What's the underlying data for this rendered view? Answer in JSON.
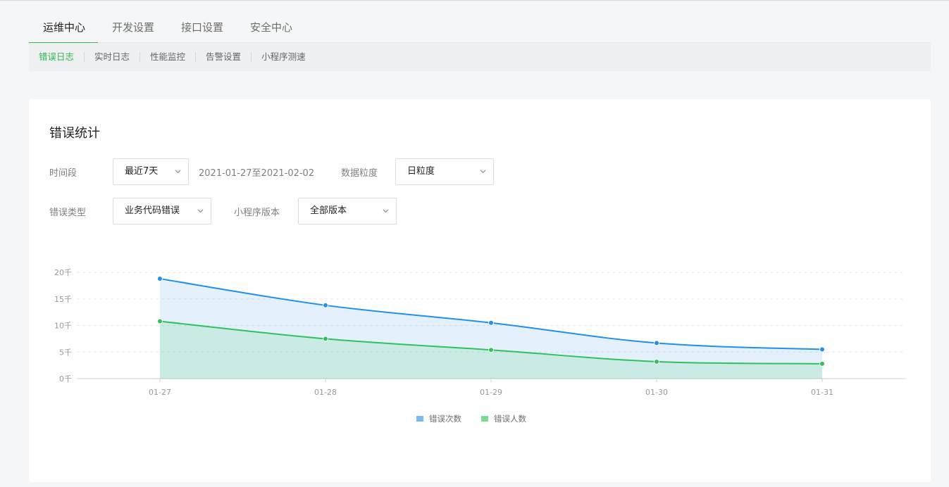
{
  "main_tabs": [
    {
      "label": "运维中心"
    },
    {
      "label": "开发设置"
    },
    {
      "label": "接口设置"
    },
    {
      "label": "安全中心"
    }
  ],
  "sub_tabs": [
    {
      "label": "错误日志"
    },
    {
      "label": "实时日志"
    },
    {
      "label": "性能监控"
    },
    {
      "label": "告警设置"
    },
    {
      "label": "小程序测速"
    }
  ],
  "card": {
    "title": "错误统计",
    "filters": {
      "period_label": "时间段",
      "period_value": "最近7天",
      "date_range": "2021-01-27至2021-02-02",
      "granularity_label": "数据粒度",
      "granularity_value": "日粒度",
      "error_type_label": "错误类型",
      "error_type_value": "业务代码错误",
      "version_label": "小程序版本",
      "version_value": "全部版本"
    }
  },
  "colors": {
    "accent": "#2fb84c",
    "series_errors": "#1f8ff0",
    "series_users": "#2fc25b"
  },
  "chart_data": {
    "type": "area",
    "x": [
      "01-27",
      "01-28",
      "01-29",
      "01-30",
      "01-31"
    ],
    "yticks": [
      "0千",
      "5千",
      "10千",
      "15千",
      "20千"
    ],
    "ylim": [
      0,
      20
    ],
    "grid": true,
    "legend_position": "bottom",
    "series": [
      {
        "name": "错误次数",
        "values": [
          18.8,
          13.8,
          10.5,
          6.7,
          5.5
        ],
        "color": "#1f8ff0"
      },
      {
        "name": "错误人数",
        "values": [
          10.8,
          7.5,
          5.4,
          3.2,
          2.8
        ],
        "color": "#2fc25b"
      }
    ]
  }
}
